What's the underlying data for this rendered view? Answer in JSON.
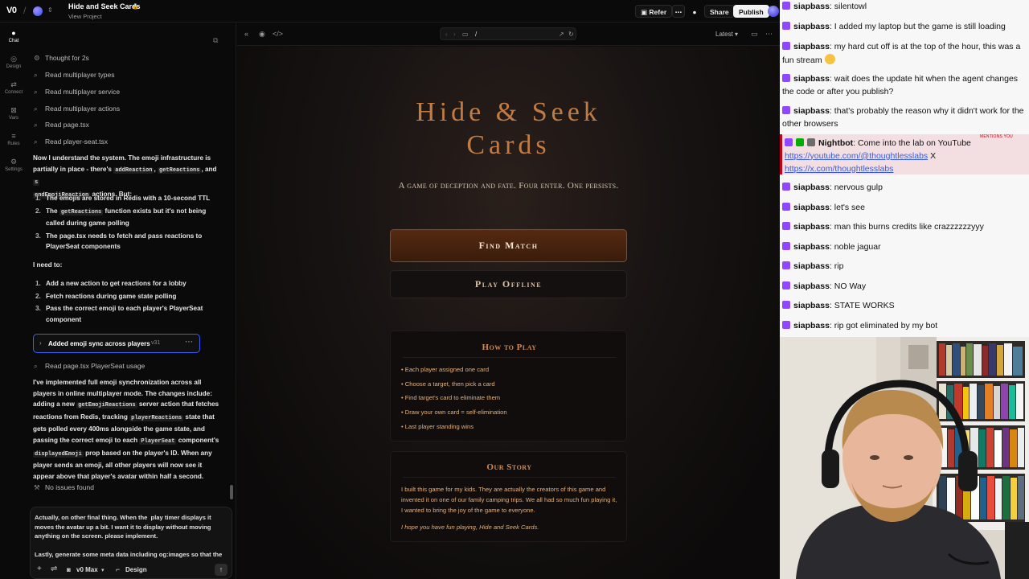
{
  "topbar": {
    "logo": "V0",
    "project_title": "Hide and Seek Cards",
    "project_sub": "View Project",
    "refer": "Refer",
    "share": "Share",
    "publish": "Publish"
  },
  "rail": {
    "items": [
      {
        "label": "Chat"
      },
      {
        "label": "Design"
      },
      {
        "label": "Connect"
      },
      {
        "label": "Vars"
      },
      {
        "label": "Rules"
      },
      {
        "label": "Settings"
      }
    ]
  },
  "chat": {
    "thought": "Thought for 2s",
    "steps": [
      "Read multiplayer types",
      "Read multiplayer service",
      "Read multiplayer actions",
      "Read page.tsx",
      "Read player-seat.tsx"
    ],
    "para1_a": "Now I understand the system. The emoji infrastructure is partially in place - there's",
    "para1_code1": "addReaction",
    "para1_code2": "getReactions",
    "para1_and": ", and",
    "para1_code3a": "s",
    "para1_code3b": "endEmojiReaction",
    "para1_b": "actions. But:",
    "list1": [
      {
        "n": "1.",
        "pre": "The emojis are stored in Redis with a 10-second TTL",
        "code": "",
        "post": ""
      },
      {
        "n": "2.",
        "pre": "The",
        "code": "getReactions",
        "post": "function exists but it's not being called during game polling"
      },
      {
        "n": "3.",
        "pre": "The page.tsx needs to fetch and pass reactions to PlayerSeat components",
        "code": "",
        "post": ""
      }
    ],
    "need": "I need to:",
    "list2": [
      {
        "n": "1.",
        "text": "Add a new action to get reactions for a lobby"
      },
      {
        "n": "2.",
        "text": "Fetch reactions during game state polling"
      },
      {
        "n": "3.",
        "text": "Pass the correct emoji to each player's PlayerSeat component"
      }
    ],
    "version_label": "Added emoji sync across players",
    "version_tag": "v31",
    "read_after": "Read page.tsx PlayerSeat usage",
    "summary_1": "I've implemented full emoji synchronization across all players in online multiplayer mode. The changes include: adding a new",
    "summary_code1": "getEmojiReactions",
    "summary_2": "server action that fetches reactions from Redis, tracking",
    "summary_code2": "playerReactions",
    "summary_3": "state that gets polled every 400ms alongside the game state, and passing the correct emoji to each",
    "summary_code3": "PlayerSeat",
    "summary_4": "component's",
    "summary_code4": "displayedEmoji",
    "summary_5": "prop based on the player's ID. When any player sends an emoji, all other players will now see it appear above that player's avatar within half a second.",
    "no_issues": "No issues found",
    "composer_text": "Actually, on other final thing. When the  play timer displays it moves the avatar up a bit. I want it to display without moving anything on the screen. please implement.\n\nLastly, generate some meta data including og:images so that the",
    "model": "v0 Max",
    "design": "Design"
  },
  "preview": {
    "url": "/",
    "version_select": "Latest",
    "game": {
      "title_line1": "Hide & Seek",
      "title_line2": "Cards",
      "tagline": "A game of deception and fate. Four enter. One persists.",
      "find_match": "Find Match",
      "play_offline": "Play Offline",
      "howto_title": "How to Play",
      "rules": [
        "• Each player assigned one card",
        "• Choose a target, then pick a card",
        "• Find target's card to eliminate them",
        "• Draw your own card = self-elimination",
        "• Last player standing wins"
      ],
      "story_title": "Our Story",
      "story_text": "I built this game for my kids. They are actually the creators of this game and invented it on one of our family camping trips. We all had so much fun playing it, I wanted to bring the joy of the game to everyone.",
      "story_sign": "I hope you have fun playing, Hide and Seek Cards."
    }
  },
  "stream_chat": {
    "messages": [
      {
        "user": "siapbass",
        "text": ": silentowl"
      },
      {
        "user": "siapbass",
        "text": ": I added my laptop but the game is still loading"
      },
      {
        "user": "siapbass",
        "text": ": my hard cut off is at the top of the hour, this was a fun stream"
      },
      {
        "user": "siapbass",
        "text": ": wait does the update hit when the agent changes the code or after you publish?"
      },
      {
        "user": "siapbass",
        "text": ": that's probably the reason why it didn't work for the other browsers"
      }
    ],
    "nightbot": {
      "user": "Nightbot",
      "text": ": Come into the lab on YouTube",
      "link1": "https://youtube.com/@thoughtlesslabs",
      "sep": " X ",
      "link2": "https://x.com/thoughtlesslabs",
      "mention": "MENTIONS YOU"
    },
    "messages2": [
      {
        "user": "siapbass",
        "text": ": nervous gulp"
      },
      {
        "user": "siapbass",
        "text": ": let's see"
      },
      {
        "user": "siapbass",
        "text": ": man this burns credits like crazzzzzzyyy"
      },
      {
        "user": "siapbass",
        "text": ": noble jaguar"
      },
      {
        "user": "siapbass",
        "text": ": rip"
      },
      {
        "user": "siapbass",
        "text": ": NO Way"
      },
      {
        "user": "siapbass",
        "text": ": STATE WORKS"
      },
      {
        "user": "siapbass",
        "text": ": rip got eliminated by my bot"
      }
    ]
  },
  "colors": {
    "accent_title": "#c27b43",
    "card_heading": "#d88a4e",
    "rule_text": "#e4b27d",
    "version_border": "#3a5ff0",
    "twitch_purple": "#9146ff"
  }
}
